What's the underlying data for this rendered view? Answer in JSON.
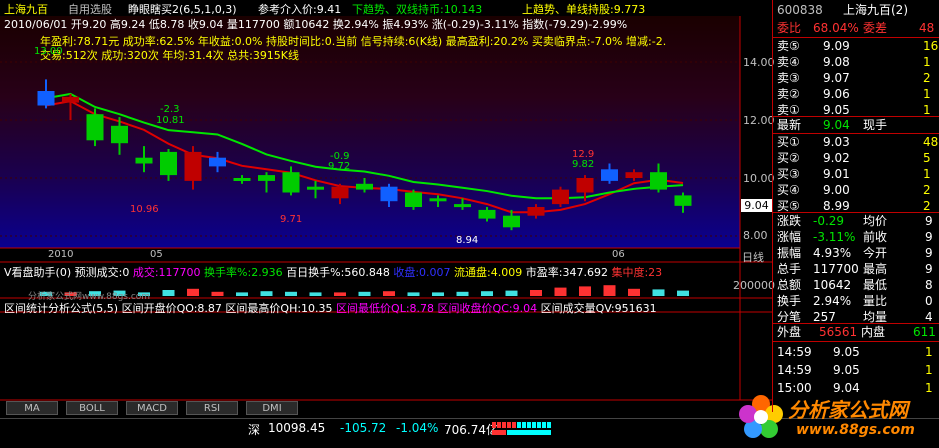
{
  "colors": {
    "up": "#ff3232",
    "down": "#00e600",
    "accent_yellow": "#ffff00",
    "bg": "#000000",
    "panel_border": "#c00000"
  },
  "topbar": {
    "title": "上海九百",
    "menu1": "自用选股",
    "formula": "睁眼瞎买2(6,5,1,0,3)",
    "ref_price": "参考介入价:9.41",
    "down_trend": "下趋势、双线持币:10.143",
    "up_trend": "上趋势、单线持股:9.773"
  },
  "infoline": {
    "date": "2010/06/01",
    "open": "开9.20",
    "high": "高9.24",
    "low": "低8.78",
    "close": "收9.04",
    "volume": "量117700",
    "amount": "额10642",
    "turnover": "换2.94%",
    "amplitude": "振4.93%",
    "change": "涨(-0.29)-3.11%",
    "index": "指数(-79.29)-2.99%"
  },
  "statsline1": {
    "year_profit": "年盈利:78.71元",
    "success_rate": "成功率:62.5%",
    "year_gain": "年收益:0.0%",
    "hold_ratio": "持股时间比:0.当前",
    "signal": "信号持续:6(K线)",
    "max_profit": "最高盈利:20.2%",
    "critical": "买卖临界点:-7.0%",
    "reduce": "增减:-2."
  },
  "statsline2": {
    "trades": "交易:512次",
    "success": "成功:320次",
    "avg": "年均:31.4次",
    "total": "总共:3915K线"
  },
  "price_axis": [
    "14.00",
    "12.00",
    "10.00",
    "8.00"
  ],
  "current_price_tag": "9.04",
  "time_axis": [
    "2010",
    "05",
    "06"
  ],
  "time_axis_right": "日线",
  "annotations": [
    {
      "text": "13.00",
      "color": "green"
    },
    {
      "text": "-2.3",
      "color": "green"
    },
    {
      "text": "10.81",
      "color": "green"
    },
    {
      "text": "10.96",
      "color": "red"
    },
    {
      "text": "-0.9",
      "color": "green"
    },
    {
      "text": "9.72",
      "color": "green"
    },
    {
      "text": "9.71",
      "color": "red"
    },
    {
      "text": "12.9",
      "color": "red"
    },
    {
      "text": "9.82",
      "color": "green"
    },
    {
      "text": "8.94",
      "color": "white"
    }
  ],
  "volume_panel": {
    "title": "V看盘助手(0)",
    "forecast": "预测成交:0",
    "volume": "成交:117700",
    "turnover": "换手率%:2.936",
    "hundred_day": "百日换手%:560.848",
    "close": "收盘:0.007",
    "float": "流通盘:4.009",
    "pe": "市盈率:347.692",
    "concentration": "集中度:23",
    "axis_value": "200000",
    "watermark": "分析家公式网www.88gs.com"
  },
  "stat_panel": {
    "title": "区间统计分析公式(5,5)",
    "open": "区间开盘价QO:8.87",
    "high": "区间最高价QH:10.35",
    "low": "区间最低价QL:8.78",
    "close": "区间收盘价QC:9.04",
    "vol": "区间成交量QV:951631"
  },
  "tabs": [
    "MA",
    "BOLL",
    "MACD",
    "RSI",
    "DMI"
  ],
  "statusbar": {
    "market": "深",
    "index": "10098.45",
    "change": "-105.72",
    "pct": "-1.04%",
    "amount": "706.74亿",
    "logo": "分析家公式网",
    "url": "www.88gs.com"
  },
  "right_panel": {
    "code": "600838",
    "name": "上海九百(2)",
    "weibi_label": "委比",
    "weibi_value": "68.04%",
    "weicha_label": "委差",
    "weicha_value": "48",
    "sells": [
      {
        "label": "卖⑤",
        "price": "9.09",
        "vol": "16"
      },
      {
        "label": "卖④",
        "price": "9.08",
        "vol": "1"
      },
      {
        "label": "卖③",
        "price": "9.07",
        "vol": "2"
      },
      {
        "label": "卖②",
        "price": "9.06",
        "vol": "1"
      },
      {
        "label": "卖①",
        "price": "9.05",
        "vol": "1"
      }
    ],
    "latest_label": "最新",
    "latest_price": "9.04",
    "latest_hand_label": "现手",
    "buys": [
      {
        "label": "买①",
        "price": "9.03",
        "vol": "48"
      },
      {
        "label": "买②",
        "price": "9.02",
        "vol": "5"
      },
      {
        "label": "买③",
        "price": "9.01",
        "vol": "1"
      },
      {
        "label": "买④",
        "price": "9.00",
        "vol": "2"
      },
      {
        "label": "买⑤",
        "price": "8.99",
        "vol": "2"
      }
    ],
    "stats": [
      {
        "l1": "涨跌",
        "v1": "-0.29",
        "l2": "均价",
        "v2": "9"
      },
      {
        "l1": "涨幅",
        "v1": "-3.11%",
        "l2": "前收",
        "v2": "9"
      },
      {
        "l1": "振幅",
        "v1": "4.93%",
        "l2": "今开",
        "v2": "9"
      },
      {
        "l1": "总手",
        "v1": "117700",
        "l2": "最高",
        "v2": "9"
      },
      {
        "l1": "总额",
        "v1": "10642",
        "l2": "最低",
        "v2": "8"
      },
      {
        "l1": "换手",
        "v1": "2.94%",
        "l2": "量比",
        "v2": "0"
      },
      {
        "l1": "分笔",
        "v1": "257",
        "l2": "均量",
        "v2": "4"
      }
    ],
    "outer_label": "外盘",
    "outer_value": "56561",
    "inner_label": "内盘",
    "inner_value": "611",
    "ticks": [
      {
        "time": "14:59",
        "price": "9.05",
        "vol": "1"
      },
      {
        "time": "14:59",
        "price": "9.05",
        "vol": "1"
      },
      {
        "time": "15:00",
        "price": "9.04",
        "vol": "1"
      }
    ]
  },
  "candles": [
    {
      "o": 13.0,
      "h": 13.4,
      "l": 12.4,
      "c": 12.5
    },
    {
      "o": 12.6,
      "h": 12.9,
      "l": 12.0,
      "c": 12.8
    },
    {
      "o": 12.2,
      "h": 12.4,
      "l": 11.1,
      "c": 11.3
    },
    {
      "o": 11.8,
      "h": 12.1,
      "l": 10.8,
      "c": 11.2
    },
    {
      "o": 10.7,
      "h": 11.1,
      "l": 10.2,
      "c": 10.5
    },
    {
      "o": 10.9,
      "h": 11.0,
      "l": 9.9,
      "c": 10.1
    },
    {
      "o": 9.9,
      "h": 11.1,
      "l": 9.6,
      "c": 10.9
    },
    {
      "o": 10.4,
      "h": 10.9,
      "l": 10.2,
      "c": 10.7
    },
    {
      "o": 10.0,
      "h": 10.1,
      "l": 9.8,
      "c": 9.9
    },
    {
      "o": 10.1,
      "h": 10.2,
      "l": 9.5,
      "c": 9.9
    },
    {
      "o": 10.2,
      "h": 10.4,
      "l": 9.4,
      "c": 9.5
    },
    {
      "o": 9.7,
      "h": 9.9,
      "l": 9.3,
      "c": 9.6
    },
    {
      "o": 9.3,
      "h": 9.8,
      "l": 9.1,
      "c": 9.7
    },
    {
      "o": 9.8,
      "h": 10.0,
      "l": 9.5,
      "c": 9.6
    },
    {
      "o": 9.2,
      "h": 9.8,
      "l": 9.0,
      "c": 9.7
    },
    {
      "o": 9.5,
      "h": 9.6,
      "l": 8.9,
      "c": 9.0
    },
    {
      "o": 9.3,
      "h": 9.4,
      "l": 9.0,
      "c": 9.2
    },
    {
      "o": 9.1,
      "h": 9.3,
      "l": 8.9,
      "c": 9.0
    },
    {
      "o": 8.9,
      "h": 9.0,
      "l": 8.5,
      "c": 8.6
    },
    {
      "o": 8.7,
      "h": 8.9,
      "l": 8.2,
      "c": 8.3
    },
    {
      "o": 8.7,
      "h": 9.1,
      "l": 8.6,
      "c": 9.0
    },
    {
      "o": 9.1,
      "h": 9.7,
      "l": 9.0,
      "c": 9.6
    },
    {
      "o": 9.5,
      "h": 10.1,
      "l": 9.2,
      "c": 10.0
    },
    {
      "o": 9.9,
      "h": 10.5,
      "l": 9.8,
      "c": 10.3
    },
    {
      "o": 10.0,
      "h": 10.3,
      "l": 9.9,
      "c": 10.2
    },
    {
      "o": 10.2,
      "h": 10.5,
      "l": 9.5,
      "c": 9.6
    },
    {
      "o": 9.4,
      "h": 9.5,
      "l": 8.8,
      "c": 9.04
    }
  ],
  "volumes": [
    0.35,
    0.3,
    0.4,
    0.45,
    0.3,
    0.5,
    0.6,
    0.35,
    0.3,
    0.4,
    0.35,
    0.3,
    0.3,
    0.35,
    0.4,
    0.3,
    0.3,
    0.35,
    0.4,
    0.45,
    0.5,
    0.7,
    0.8,
    0.9,
    0.6,
    0.55,
    0.45
  ]
}
